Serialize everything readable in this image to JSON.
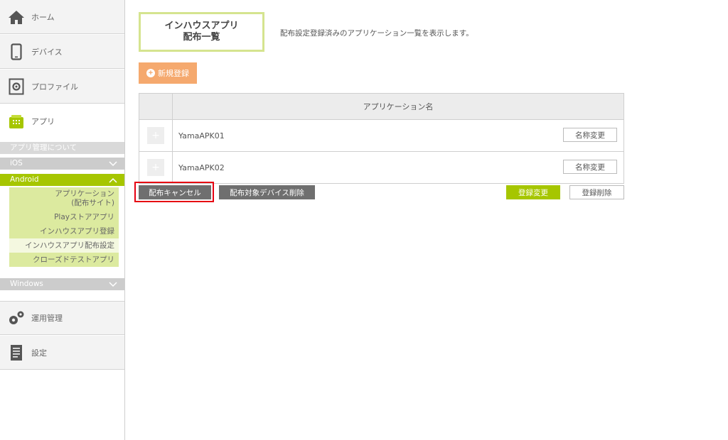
{
  "sidebar": {
    "nav": [
      {
        "label": "ホーム",
        "icon": "home-icon"
      },
      {
        "label": "デバイス",
        "icon": "smartphone-icon"
      },
      {
        "label": "プロファイル",
        "icon": "profile-gear-icon"
      },
      {
        "label": "アプリ",
        "icon": "app-icon"
      }
    ],
    "app_sub": {
      "about": "アプリ管理について",
      "ios": "iOS",
      "android": "Android",
      "android_items": [
        {
          "label_line1": "アプリケーション",
          "label_line2": "(配布サイト)"
        },
        {
          "label": "Playストアアプリ"
        },
        {
          "label": "インハウスアプリ登録"
        },
        {
          "label": "インハウスアプリ配布設定"
        },
        {
          "label": "クローズドテストアプリ"
        }
      ],
      "windows": "Windows"
    },
    "bottom_nav": [
      {
        "label": "運用管理",
        "icon": "operation-gears-icon"
      },
      {
        "label": "設定",
        "icon": "settings-document-icon"
      }
    ]
  },
  "main": {
    "title_line1": "インハウスアプリ",
    "title_line2": "配布一覧",
    "description": "配布設定登録済みのアプリケーション一覧を表示します。",
    "new_button": "新規登録",
    "table": {
      "header": "アプリケーション名",
      "rows": [
        {
          "name": "YamaAPK01",
          "action": "名称変更"
        },
        {
          "name": "YamaAPK02",
          "action": "名称変更"
        }
      ]
    },
    "actions": {
      "cancel_distribution": "配布キャンセル",
      "delete_target_devices": "配布対象デバイス削除",
      "update_registration": "登録変更",
      "delete_registration": "登録削除"
    }
  },
  "colors": {
    "accent_green": "#a6c600",
    "orange": "#f5a96e",
    "highlight_red": "#e60012"
  }
}
